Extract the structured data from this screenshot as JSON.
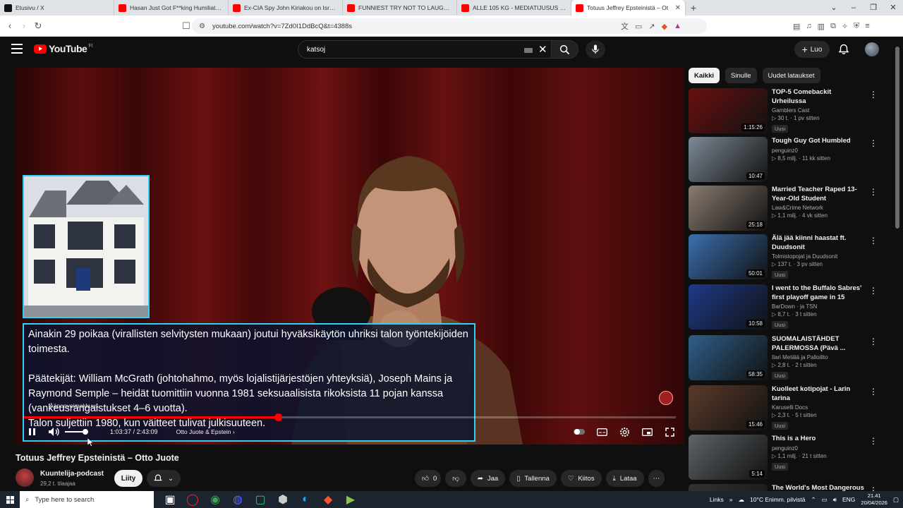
{
  "browser": {
    "tabs": [
      {
        "title": "Etusivu / X",
        "color": "#111111"
      },
      {
        "title": "Hasan Just Got F**king Humiliated...",
        "color": "#ff0000"
      },
      {
        "title": "Ex-CIA Spy John Kiriakou on Israel, D...",
        "color": "#ff0000"
      },
      {
        "title": "FUNNIEST TRY NOT TO LAUGH AFTE...",
        "color": "#ff0000"
      },
      {
        "title": "ALLE 105 KG - MEDIATIJUSUS - You...",
        "color": "#ff0000"
      },
      {
        "title": "Totuus Jeffrey Epsteinistä – Ot",
        "color": "#ff0000"
      }
    ],
    "url": "youtube.com/watch?v=7Zd0I1DdBcQ&t=4388s"
  },
  "youtube": {
    "logo_text": "YouTube",
    "region": "FI",
    "search_value": "katsoj",
    "create_label": "Luo"
  },
  "player": {
    "captions": [
      "Ainakin 29 poikaa (virallisten selvitysten mukaan) joutui hyväksikäytön uhriksi talon työntekijöiden toimesta.",
      "Päätekijät: William McGrath (johtohahmo, myös lojalistijärjestöjen yhteyksiä), Joseph Mains ja Raymond Semple – heidät tuomittiin vuonna 1981 seksuaalisista rikoksista 11 pojan kanssa (vankeusrangaistukset 4–6 vuotta).",
      "Talon suljettiin 1980, kun väitteet tulivat julkisuuteen."
    ],
    "tooltip": "Äänenvoimakkuus",
    "time": "1:03:37 / 2:43:09",
    "chapter": "Otto Juote & Epstein",
    "progress_fraction": 0.39,
    "volume_fraction": 0.9
  },
  "video": {
    "title": "Totuus Jeffrey Epsteinistä – Otto Juote",
    "channel": "Kuuntelija-podcast",
    "subscribers": "29,2 t. tilaajaa",
    "join_label": "Liity",
    "likes": "0",
    "share_label": "Jaa",
    "save_label": "Tallenna",
    "thanks_label": "Kiitos",
    "download_label": "Lataa"
  },
  "chips": [
    "Kaikki",
    "Sinulle",
    "Uudet lataukset"
  ],
  "recommendations": [
    {
      "title": "TOP-5 Comebackit Urheilussa",
      "channel": "Gamblers Cast",
      "meta": "30 t. · 1 pv sitten",
      "badge": "Uusi",
      "duration": "1:15:26",
      "thumb": "#6a1010"
    },
    {
      "title": "Tough Guy Got Humbled",
      "channel": "penguinz0",
      "meta": "8,5 milj. · 11 kk sitten",
      "badge": "",
      "duration": "10:47",
      "thumb": "#7d8a96"
    },
    {
      "title": "Married Teacher Raped 13-Year-Old Student",
      "channel": "Law&Crime Network",
      "meta": "1,1 milj. · 4 vk sitten",
      "badge": "",
      "duration": "25:18",
      "thumb": "#8a7c70"
    },
    {
      "title": "Älä jää kiinni haastat ft. Duudsonit",
      "channel": "Tolmistopojat ja Duudsonit",
      "meta": "137 t. · 3 pv sitten",
      "badge": "Uusi",
      "duration": "50:01",
      "thumb": "#3b6fb0"
    },
    {
      "title": "I went to the Buffalo Sabres' first playoff game in 15 years!",
      "channel": "BarDown · ja TSN",
      "meta": "8,7 t. · 3 t sitten",
      "badge": "Uusi",
      "duration": "10:58",
      "thumb": "#1e3a8a"
    },
    {
      "title": "SUOMALAISTÄHDET PALERMOSSA (Pävä ...",
      "channel": "Ilari Metälä ja Palloilito",
      "meta": "2,8 t. · 2 t sitten",
      "badge": "Uusi",
      "duration": "58:35",
      "thumb": "#2f5f8a"
    },
    {
      "title": "Kuolleet kotipojat - Larin tarina",
      "channel": "Karuselli Docs",
      "meta": "2,3 t. · 5 t sitten",
      "badge": "Uusi",
      "duration": "15:46",
      "thumb": "#5a3a2a"
    },
    {
      "title": "This is a Hero",
      "channel": "penguinz0",
      "meta": "1,1 milj. · 21 t sitten",
      "badge": "Uusi",
      "duration": "5:14",
      "thumb": "#5e6468"
    },
    {
      "title": "The World's Most Dangerous",
      "channel": "",
      "meta": "",
      "badge": "",
      "duration": "",
      "thumb": "#333333"
    }
  ],
  "taskbar": {
    "search_placeholder": "Type here to search",
    "links": "Links",
    "weather": "10°C  Enimm. pilvistä",
    "lang": "ENG",
    "time": "21.41",
    "date": "20/04/2026"
  }
}
